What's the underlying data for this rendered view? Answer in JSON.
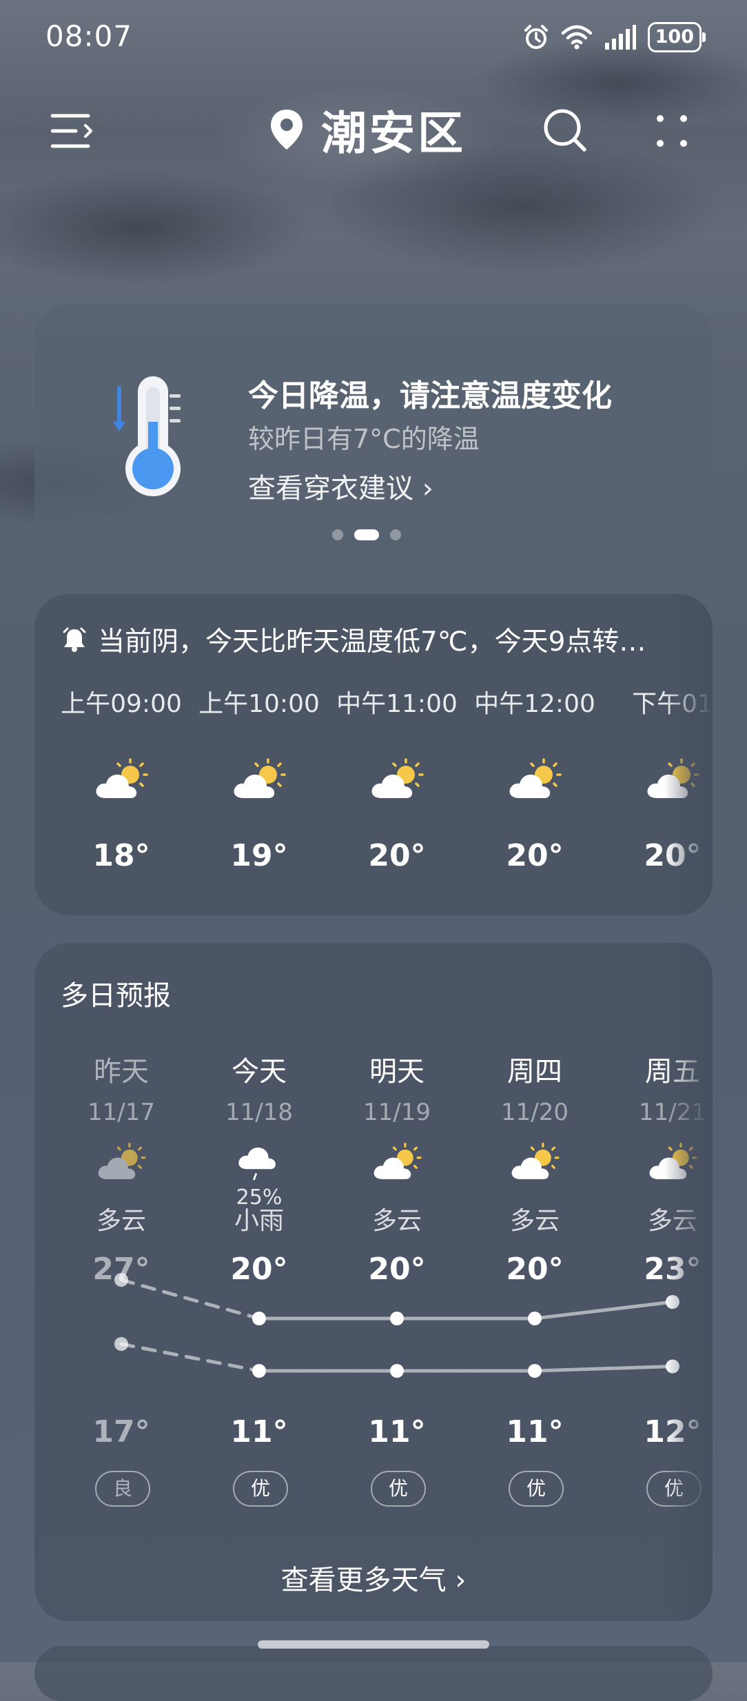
{
  "status_bar": {
    "time": "08:07",
    "battery": "100",
    "icons": [
      "alarm-icon",
      "wifi-icon",
      "signal-icon",
      "battery-icon"
    ]
  },
  "header": {
    "city": "潮安区",
    "icons": [
      "menu-icon",
      "location-pin-icon",
      "search-icon",
      "more-icon"
    ]
  },
  "alert": {
    "title": "今日降温，请注意温度变化",
    "subtitle": "较昨日有7°C的降温",
    "link": "查看穿衣建议 ›",
    "page_count": 3,
    "active_page": 2
  },
  "hourly": {
    "summary": "当前阴，今天比昨天温度低7℃，今天9点转…",
    "hours": [
      {
        "time": "上午09:00",
        "temp": "18°",
        "icon": "partly-cloudy-icon"
      },
      {
        "time": "上午10:00",
        "temp": "19°",
        "icon": "partly-cloudy-icon"
      },
      {
        "time": "中午11:00",
        "temp": "20°",
        "icon": "partly-cloudy-icon"
      },
      {
        "time": "中午12:00",
        "temp": "20°",
        "icon": "partly-cloudy-icon"
      },
      {
        "time": "下午01",
        "temp": "20°",
        "icon": "partly-cloudy-icon"
      }
    ]
  },
  "daily": {
    "title": "多日预报",
    "days": [
      {
        "name": "昨天",
        "date": "11/17",
        "icon": "partly-cloudy-icon",
        "pop": "",
        "condition": "多云",
        "high": "27°",
        "low": "17°",
        "aqi": "良",
        "high_value": 27,
        "low_value": 17
      },
      {
        "name": "今天",
        "date": "11/18",
        "icon": "light-rain-icon",
        "pop": "25%",
        "condition": "小雨",
        "high": "20°",
        "low": "11°",
        "aqi": "优",
        "high_value": 20,
        "low_value": 11
      },
      {
        "name": "明天",
        "date": "11/19",
        "icon": "partly-cloudy-icon",
        "pop": "",
        "condition": "多云",
        "high": "20°",
        "low": "11°",
        "aqi": "优",
        "high_value": 20,
        "low_value": 11
      },
      {
        "name": "周四",
        "date": "11/20",
        "icon": "partly-cloudy-icon",
        "pop": "",
        "condition": "多云",
        "high": "20°",
        "low": "11°",
        "aqi": "优",
        "high_value": 20,
        "low_value": 11
      },
      {
        "name": "周五",
        "date": "11/21",
        "icon": "partly-cloudy-icon",
        "pop": "",
        "condition": "多云",
        "high": "23°",
        "low": "12°",
        "aqi": "优",
        "high_value": 23,
        "low_value": 12
      }
    ],
    "more_link": "查看更多天气 ›"
  },
  "colors": {
    "sun": "#f5c84a",
    "cloud": "#ffffff",
    "thermometer_bulb": "#4a98f0",
    "line": "rgba(255,255,255,0.55)"
  }
}
